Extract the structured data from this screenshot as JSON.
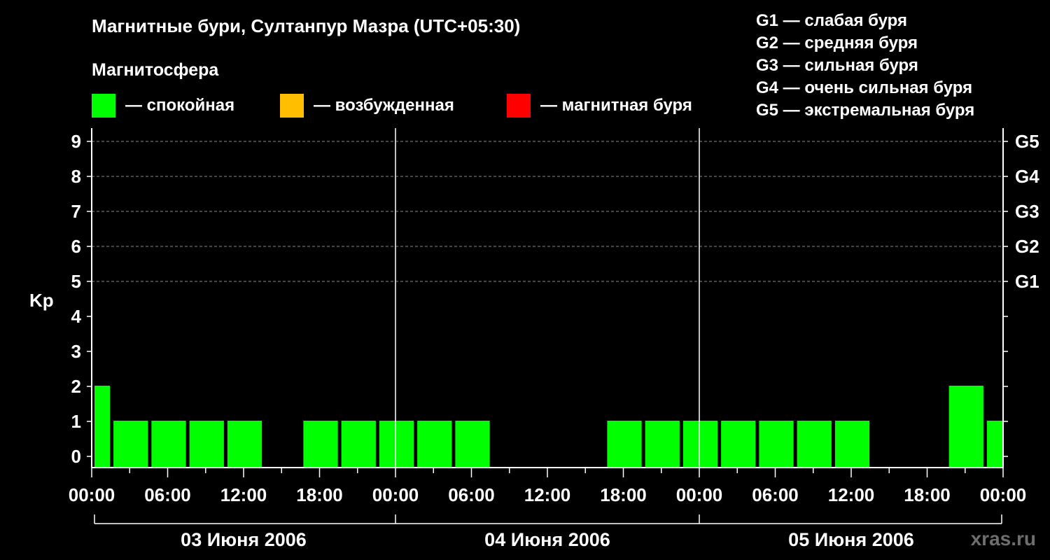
{
  "header": {
    "title": "Магнитные бури, Султанпур Мазра (UTC+05:30)",
    "magnetosphere_title": "Магнитосфера"
  },
  "legend": {
    "quiet": {
      "label": "— спокойная",
      "color": "#00ff00"
    },
    "active": {
      "label": "— возбужденная",
      "color": "#ffbf00"
    },
    "storm": {
      "label": "— магнитная буря",
      "color": "#ff0000"
    }
  },
  "g_legend": [
    "G1 — слабая буря",
    "G2 — средняя буря",
    "G3 — сильная буря",
    "G4 — очень сильная буря",
    "G5 — экстремальная буря"
  ],
  "watermark": "xras.ru",
  "chart_data": {
    "type": "bar",
    "ylabel": "Kp",
    "ylim": [
      0,
      9
    ],
    "y_ticks": [
      "0",
      "1",
      "2",
      "3",
      "4",
      "5",
      "6",
      "7",
      "8",
      "9"
    ],
    "right_axis_ticks": [
      {
        "value": 5,
        "label": "G1"
      },
      {
        "value": 6,
        "label": "G2"
      },
      {
        "value": 7,
        "label": "G3"
      },
      {
        "value": 8,
        "label": "G4"
      },
      {
        "value": 9,
        "label": "G5"
      }
    ],
    "x_tick_labels": [
      "00:00",
      "06:00",
      "12:00",
      "18:00",
      "00:00",
      "06:00",
      "12:00",
      "18:00",
      "00:00",
      "06:00",
      "12:00",
      "18:00",
      "00:00"
    ],
    "day_labels": [
      "03 Июня 2006",
      "04 Июня 2006",
      "05 Июня 2006"
    ],
    "grid": "horizontal dashed lines at Kp 5–9",
    "bar_color": "#00ff00",
    "bars": [
      {
        "start_h": 0,
        "end_h": 1.5,
        "kp": 2
      },
      {
        "start_h": 1.5,
        "end_h": 4.5,
        "kp": 1
      },
      {
        "start_h": 4.5,
        "end_h": 7.5,
        "kp": 1
      },
      {
        "start_h": 7.5,
        "end_h": 10.5,
        "kp": 1
      },
      {
        "start_h": 10.5,
        "end_h": 13.5,
        "kp": 1
      },
      {
        "start_h": 16.5,
        "end_h": 19.5,
        "kp": 1
      },
      {
        "start_h": 19.5,
        "end_h": 22.5,
        "kp": 1
      },
      {
        "start_h": 22.5,
        "end_h": 25.5,
        "kp": 1
      },
      {
        "start_h": 25.5,
        "end_h": 28.5,
        "kp": 1
      },
      {
        "start_h": 28.5,
        "end_h": 31.5,
        "kp": 1
      },
      {
        "start_h": 40.5,
        "end_h": 43.5,
        "kp": 1
      },
      {
        "start_h": 43.5,
        "end_h": 46.5,
        "kp": 1
      },
      {
        "start_h": 46.5,
        "end_h": 49.5,
        "kp": 1
      },
      {
        "start_h": 49.5,
        "end_h": 52.5,
        "kp": 1
      },
      {
        "start_h": 52.5,
        "end_h": 55.5,
        "kp": 1
      },
      {
        "start_h": 55.5,
        "end_h": 58.5,
        "kp": 1
      },
      {
        "start_h": 58.5,
        "end_h": 61.5,
        "kp": 1
      },
      {
        "start_h": 67.5,
        "end_h": 70.5,
        "kp": 2
      },
      {
        "start_h": 70.5,
        "end_h": 72,
        "kp": 1
      }
    ]
  }
}
